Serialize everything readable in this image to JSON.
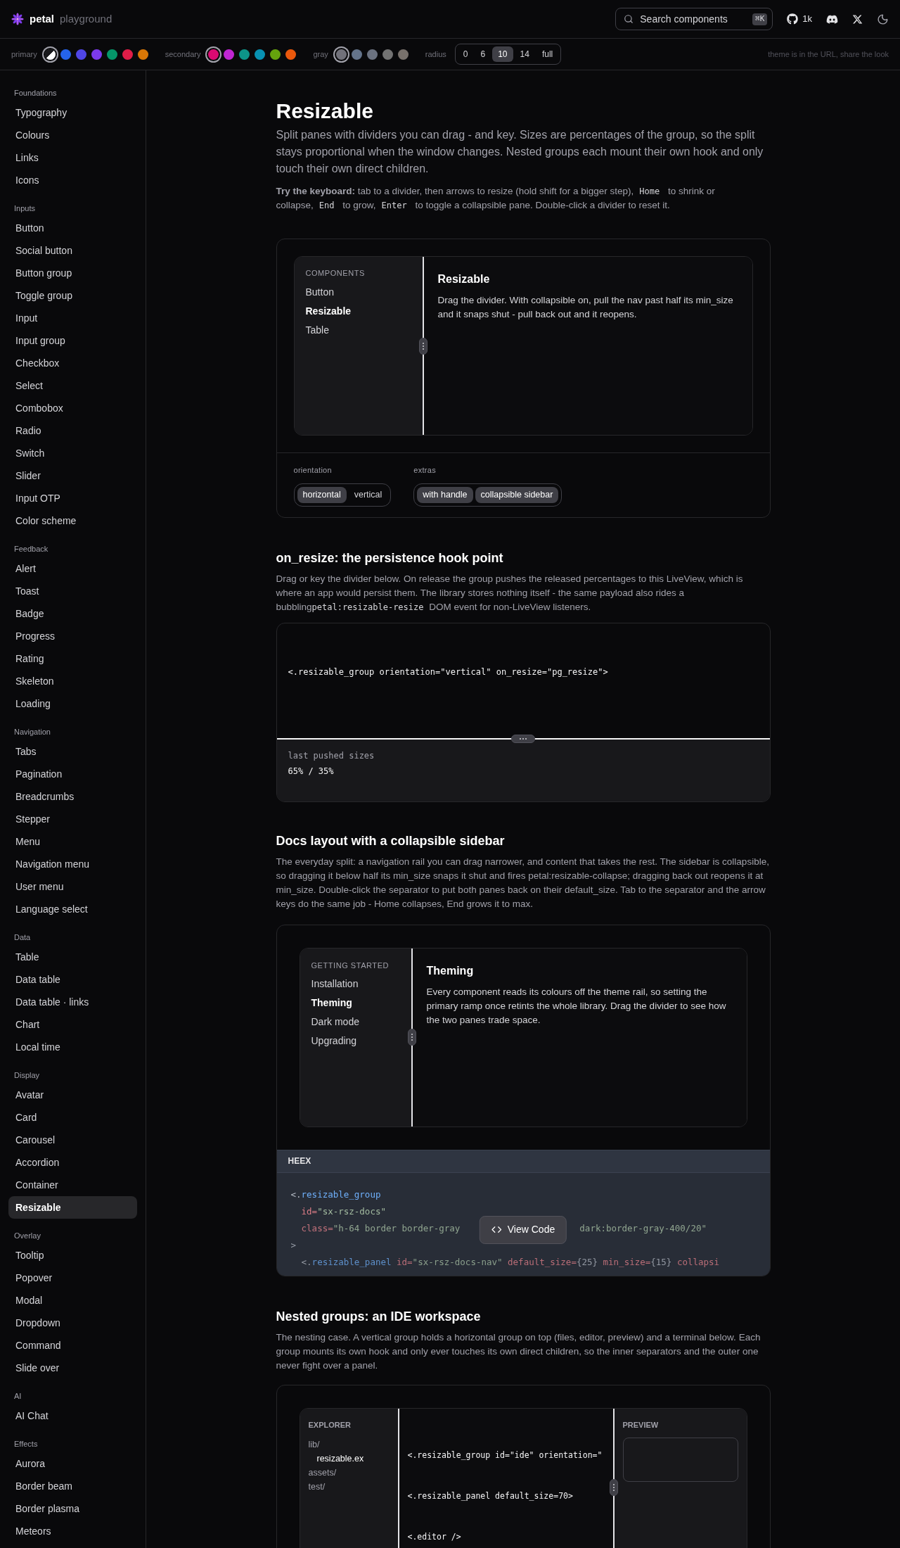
{
  "header": {
    "brand": "petal",
    "subtitle": "playground",
    "search": {
      "placeholder": "Search components",
      "shortcut": "⌘K"
    },
    "github_count": "1k"
  },
  "theme_bar": {
    "groups": [
      {
        "label": "primary",
        "swatches": [
          {
            "kind": "split",
            "selected": true
          },
          {
            "kind": "solid",
            "color": "#2563eb",
            "selected": false
          },
          {
            "kind": "solid",
            "color": "#4f46e5",
            "selected": false
          },
          {
            "kind": "solid",
            "color": "#7c3aed",
            "selected": false
          },
          {
            "kind": "solid",
            "color": "#059669",
            "selected": false
          },
          {
            "kind": "solid",
            "color": "#e11d48",
            "selected": false
          },
          {
            "kind": "solid",
            "color": "#d97706",
            "selected": false
          }
        ]
      },
      {
        "label": "secondary",
        "swatches": [
          {
            "kind": "solid",
            "color": "#db0a72",
            "selected": true
          },
          {
            "kind": "solid",
            "color": "#c026d3",
            "selected": false
          },
          {
            "kind": "solid",
            "color": "#0d9488",
            "selected": false
          },
          {
            "kind": "solid",
            "color": "#0891b2",
            "selected": false
          },
          {
            "kind": "solid",
            "color": "#65a30d",
            "selected": false
          },
          {
            "kind": "solid",
            "color": "#ea580c",
            "selected": false
          }
        ]
      },
      {
        "label": "gray",
        "swatches": [
          {
            "kind": "solid",
            "color": "#71717a",
            "selected": true
          },
          {
            "kind": "solid",
            "color": "#64748b",
            "selected": false
          },
          {
            "kind": "solid",
            "color": "#6b7280",
            "selected": false
          },
          {
            "kind": "solid",
            "color": "#737373",
            "selected": false
          },
          {
            "kind": "solid",
            "color": "#78716c",
            "selected": false
          }
        ]
      }
    ],
    "radius": {
      "label": "radius",
      "options": [
        {
          "label": "0",
          "selected": false
        },
        {
          "label": "6",
          "selected": false
        },
        {
          "label": "10",
          "selected": true
        },
        {
          "label": "14",
          "selected": false
        },
        {
          "label": "full",
          "selected": false
        }
      ]
    },
    "note": "theme is in the URL, share the look"
  },
  "sidebar": {
    "sections": [
      {
        "title": "Foundations",
        "items": [
          {
            "label": "Typography",
            "selected": false
          },
          {
            "label": "Colours",
            "selected": false
          },
          {
            "label": "Links",
            "selected": false
          },
          {
            "label": "Icons",
            "selected": false
          }
        ]
      },
      {
        "title": "Inputs",
        "items": [
          {
            "label": "Button",
            "selected": false
          },
          {
            "label": "Social button",
            "selected": false
          },
          {
            "label": "Button group",
            "selected": false
          },
          {
            "label": "Toggle group",
            "selected": false
          },
          {
            "label": "Input",
            "selected": false
          },
          {
            "label": "Input group",
            "selected": false
          },
          {
            "label": "Checkbox",
            "selected": false
          },
          {
            "label": "Select",
            "selected": false
          },
          {
            "label": "Combobox",
            "selected": false
          },
          {
            "label": "Radio",
            "selected": false
          },
          {
            "label": "Switch",
            "selected": false
          },
          {
            "label": "Slider",
            "selected": false
          },
          {
            "label": "Input OTP",
            "selected": false
          },
          {
            "label": "Color scheme",
            "selected": false
          }
        ]
      },
      {
        "title": "Feedback",
        "items": [
          {
            "label": "Alert",
            "selected": false
          },
          {
            "label": "Toast",
            "selected": false
          },
          {
            "label": "Badge",
            "selected": false
          },
          {
            "label": "Progress",
            "selected": false
          },
          {
            "label": "Rating",
            "selected": false
          },
          {
            "label": "Skeleton",
            "selected": false
          },
          {
            "label": "Loading",
            "selected": false
          }
        ]
      },
      {
        "title": "Navigation",
        "items": [
          {
            "label": "Tabs",
            "selected": false
          },
          {
            "label": "Pagination",
            "selected": false
          },
          {
            "label": "Breadcrumbs",
            "selected": false
          },
          {
            "label": "Stepper",
            "selected": false
          },
          {
            "label": "Menu",
            "selected": false
          },
          {
            "label": "Navigation menu",
            "selected": false
          },
          {
            "label": "User menu",
            "selected": false
          },
          {
            "label": "Language select",
            "selected": false
          }
        ]
      },
      {
        "title": "Data",
        "items": [
          {
            "label": "Table",
            "selected": false
          },
          {
            "label": "Data table",
            "selected": false
          },
          {
            "label": "Data table · links",
            "selected": false
          },
          {
            "label": "Chart",
            "selected": false
          },
          {
            "label": "Local time",
            "selected": false
          }
        ]
      },
      {
        "title": "Display",
        "items": [
          {
            "label": "Avatar",
            "selected": false
          },
          {
            "label": "Card",
            "selected": false
          },
          {
            "label": "Carousel",
            "selected": false
          },
          {
            "label": "Accordion",
            "selected": false
          },
          {
            "label": "Container",
            "selected": false
          },
          {
            "label": "Resizable",
            "selected": true
          }
        ]
      },
      {
        "title": "Overlay",
        "items": [
          {
            "label": "Tooltip",
            "selected": false
          },
          {
            "label": "Popover",
            "selected": false
          },
          {
            "label": "Modal",
            "selected": false
          },
          {
            "label": "Dropdown",
            "selected": false
          },
          {
            "label": "Command",
            "selected": false
          },
          {
            "label": "Slide over",
            "selected": false
          }
        ]
      },
      {
        "title": "AI",
        "items": [
          {
            "label": "AI Chat",
            "selected": false
          }
        ]
      },
      {
        "title": "Effects",
        "items": [
          {
            "label": "Aurora",
            "selected": false
          },
          {
            "label": "Border beam",
            "selected": false
          },
          {
            "label": "Border plasma",
            "selected": false
          },
          {
            "label": "Meteors",
            "selected": false
          }
        ]
      }
    ]
  },
  "intro": {
    "title": "Resizable",
    "lead": "Split panes with dividers you can drag - and key. Sizes are percentages of the group, so the split stays proportional when the window changes. Nested groups each mount their own hook and only touch their own direct children.",
    "hint": [
      {
        "kind": "text",
        "text": "**Try the keyboard:** tab to a divider, then arrows to resize (hold shift for a bigger step),"
      },
      {
        "kind": "key",
        "text": "Home"
      },
      {
        "kind": "text",
        "text": "to shrink or collapse,"
      },
      {
        "kind": "key",
        "text": "End"
      },
      {
        "kind": "text",
        "text": "to grow,"
      },
      {
        "kind": "key",
        "text": "Enter"
      },
      {
        "kind": "text",
        "text": "to toggle a collapsible pane. Double-click a divider to reset it."
      }
    ]
  },
  "demo": {
    "nav_heading": "COMPONENTS",
    "nav_items": [
      {
        "label": "Button",
        "selected": false
      },
      {
        "label": "Resizable",
        "selected": true
      },
      {
        "label": "Table",
        "selected": false
      }
    ],
    "content_title": "Resizable",
    "content_text": "Drag the divider. With collapsible on, pull the nav past half its min_size and it snaps shut - pull back out and it reopens.",
    "controls": [
      {
        "label": "orientation",
        "options": [
          {
            "label": "horizontal",
            "selected": true
          },
          {
            "label": "vertical",
            "selected": false
          }
        ]
      },
      {
        "label": "extras",
        "options": [
          {
            "label": "with handle",
            "selected": true
          },
          {
            "label": "collapsible sidebar",
            "selected": true
          }
        ]
      }
    ]
  },
  "on_resize": {
    "title": "on_resize: the persistence hook point",
    "description": [
      {
        "kind": "text",
        "text": "Drag or key the divider below. On release the group pushes the released percentages to this LiveView, which is where an app would persist them. The library stores nothing itself - the same payload also rides a bubbling"
      },
      {
        "kind": "code",
        "text": "petal:resizable-resize"
      },
      {
        "kind": "text",
        "text": "DOM event for non-LiveView listeners."
      }
    ],
    "code_line": "<.resizable_group orientation=\"vertical\" on_resize=\"pg_resize\">",
    "result_label": "last pushed sizes",
    "result_value": "65% / 35%"
  },
  "docs": {
    "title": "Docs layout with a collapsible sidebar",
    "description": "The everyday split: a navigation rail you can drag narrower, and content that takes the rest. The sidebar is collapsible, so dragging it below half its min_size snaps it shut and fires petal:resizable-collapse; dragging back out reopens it at min_size. Double-click the separator to put both panes back on their default_size. Tab to the separator and the arrow keys do the same job - Home collapses, End grows it to max.",
    "nav_heading": "GETTING STARTED",
    "nav_items": [
      {
        "label": "Installation",
        "selected": false
      },
      {
        "label": "Theming",
        "selected": true
      },
      {
        "label": "Dark mode",
        "selected": false
      },
      {
        "label": "Upgrading",
        "selected": false
      }
    ],
    "content_title": "Theming",
    "content_text": "Every component reads its colours off the theme rail, so setting the primary ramp once retints the whole library. Drag the divider to see how the two panes trade space.",
    "code_label": "HEEX",
    "view_code": "View Code",
    "code_lines": [
      [
        {
          "kind": "punct",
          "text": "<."
        },
        {
          "kind": "tag",
          "text": "resizable_group"
        }
      ],
      [
        {
          "kind": "attr",
          "text": "  id="
        },
        {
          "kind": "string",
          "text": "\"sx-rsz-docs\""
        }
      ],
      [
        {
          "kind": "attr",
          "text": "  class="
        },
        {
          "kind": "string",
          "text": "\"h-64 border border-gray"
        },
        {
          "kind": "gap"
        },
        {
          "kind": "string",
          "text": "dark:border-gray-400/20\""
        }
      ],
      [
        {
          "kind": "punct",
          "text": ">"
        }
      ],
      [
        {
          "kind": "punct",
          "text": "  <."
        },
        {
          "kind": "tag",
          "text": "resizable_panel"
        },
        {
          "kind": "attr",
          "text": " id="
        },
        {
          "kind": "string",
          "text": "\"sx-rsz-docs-nav\""
        },
        {
          "kind": "attr",
          "text": " default_size="
        },
        {
          "kind": "punct",
          "text": "{25}"
        },
        {
          "kind": "attr",
          "text": " min_size="
        },
        {
          "kind": "punct",
          "text": "{15}"
        },
        {
          "kind": "attr",
          "text": " collapsi"
        }
      ]
    ]
  },
  "nested": {
    "title": "Nested groups: an IDE workspace",
    "description": "The nesting case. A vertical group holds a horizontal group on top (files, editor, preview) and a terminal below. Each group mounts its own hook and only ever touches its own direct children, so the inner separators and the outer one never fight over a panel.",
    "explorer_heading": "EXPLORER",
    "files": [
      {
        "name": "lib/",
        "selected": false,
        "children": [
          {
            "name": "resizable.ex",
            "selected": true
          }
        ]
      },
      {
        "name": "assets/",
        "selected": false
      },
      {
        "name": "test/",
        "selected": false
      }
    ],
    "editor_lines": [
      "<.resizable_group id=\"ide\" orientation=\"",
      "<.resizable_panel default_size=70>",
      "<.editor />"
    ],
    "preview_heading": "PREVIEW"
  }
}
